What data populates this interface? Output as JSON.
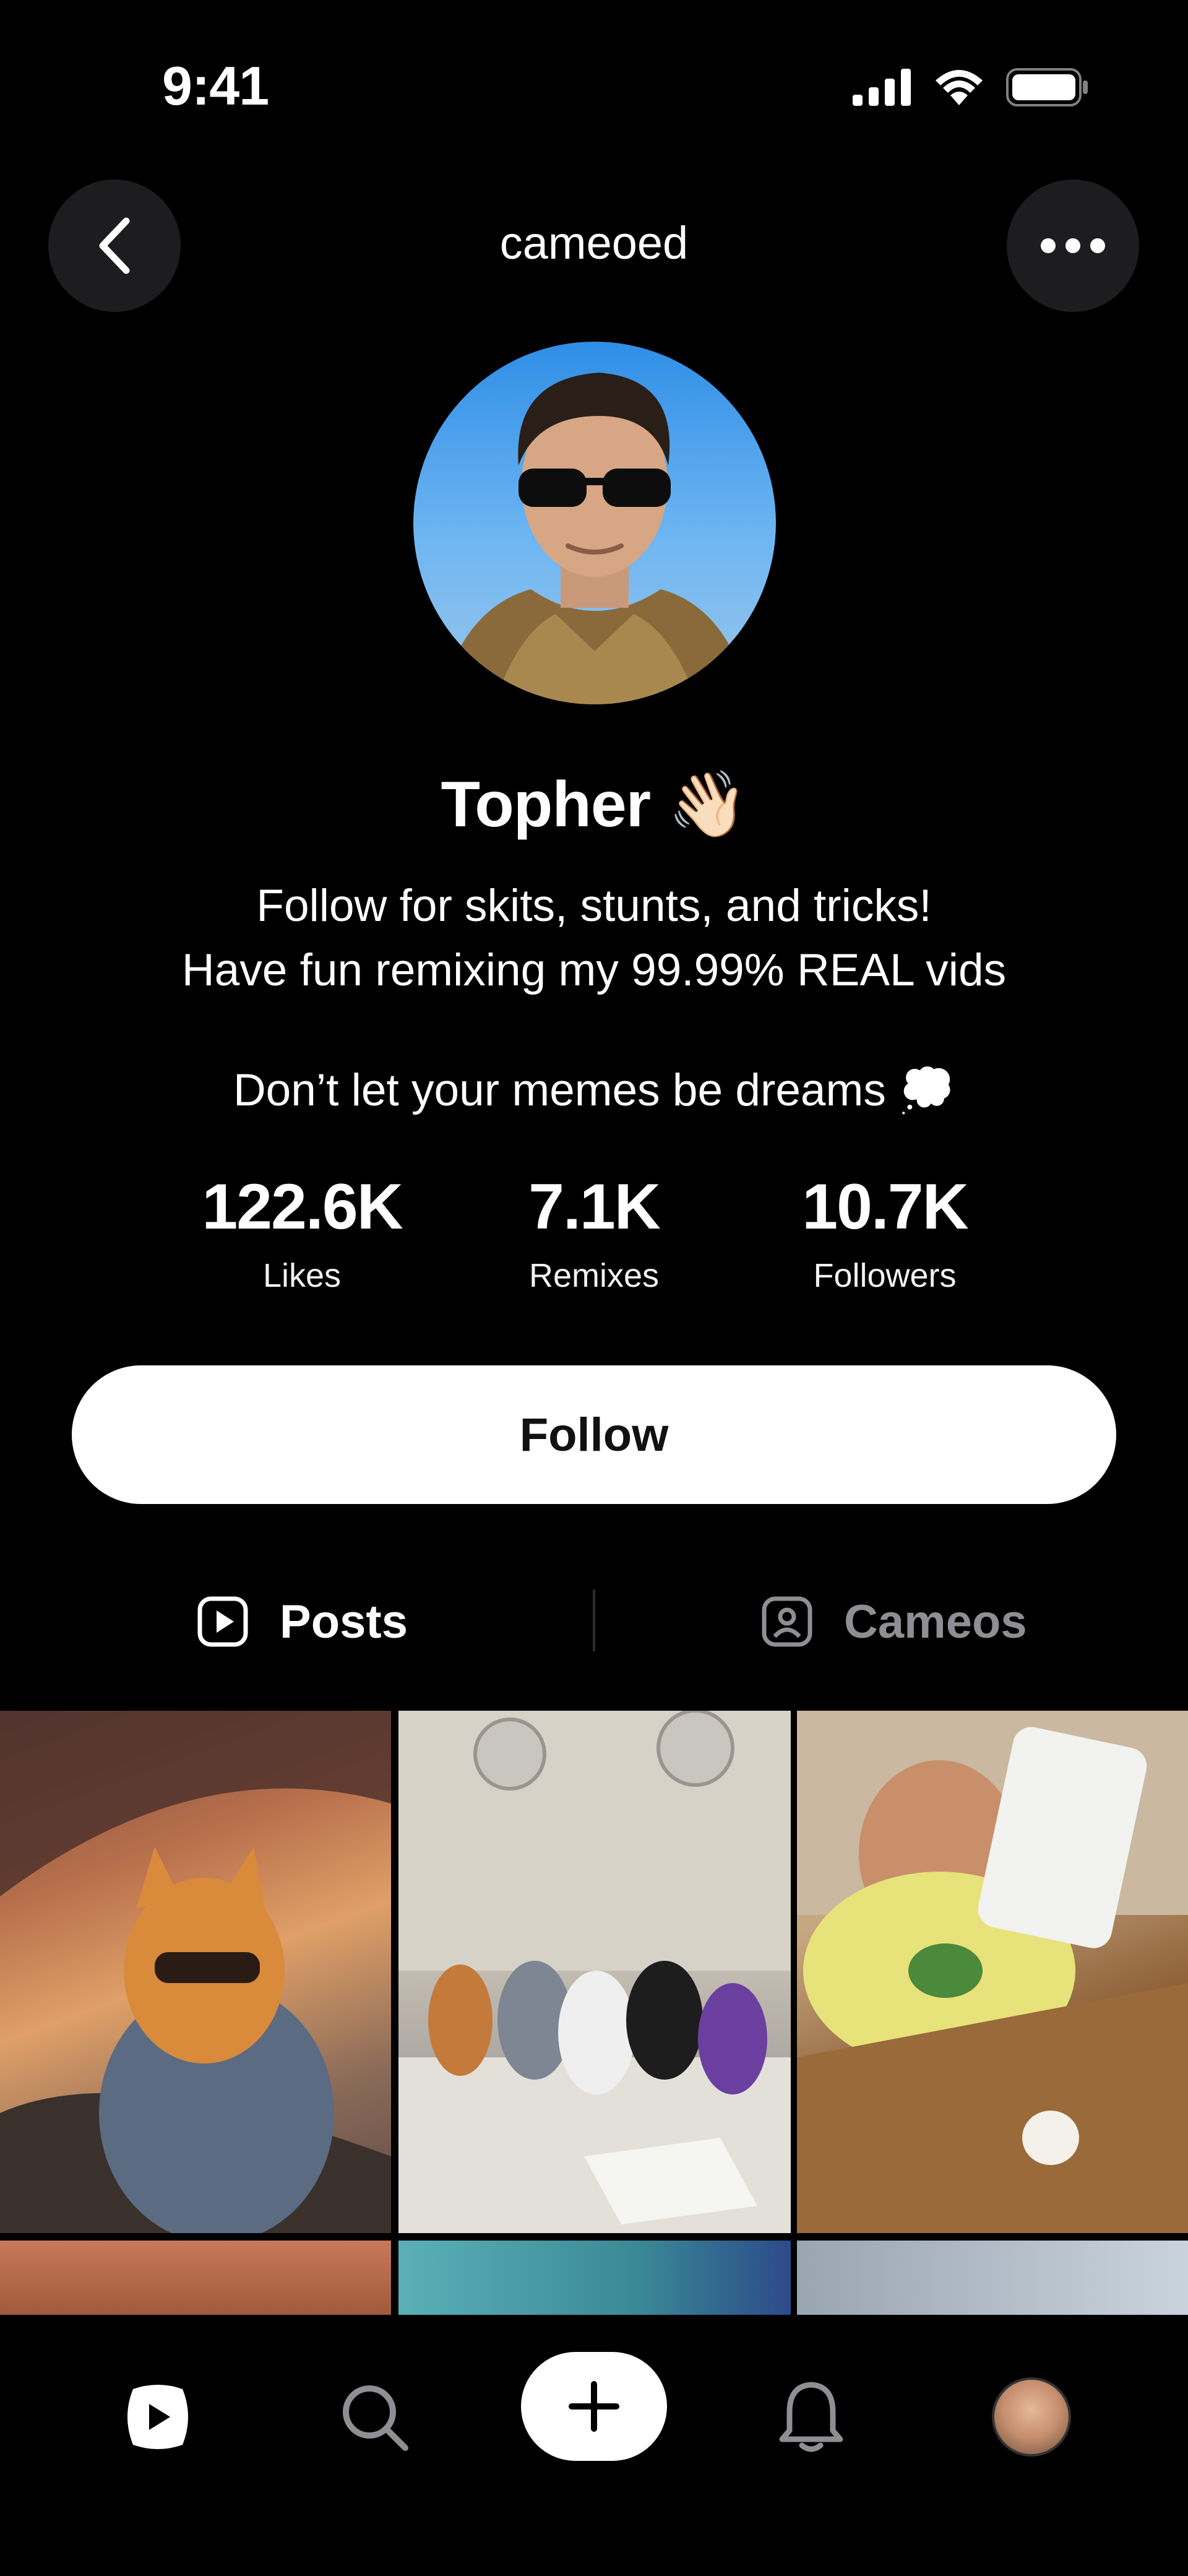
{
  "status_bar": {
    "time": "9:41"
  },
  "header": {
    "username": "cameoed"
  },
  "profile": {
    "name": "Topher 👋🏻",
    "bio_line1": "Follow for skits, stunts, and tricks!",
    "bio_line2": "Have fun remixing my 99.99% REAL vids",
    "tagline": "Don’t let your memes be dreams 💭"
  },
  "stats": [
    {
      "value": "122.6K",
      "label": "Likes"
    },
    {
      "value": "7.1K",
      "label": "Remixes"
    },
    {
      "value": "10.7K",
      "label": "Followers"
    }
  ],
  "actions": {
    "follow_label": "Follow"
  },
  "tabs": [
    {
      "label": "Posts",
      "icon": "play-square-icon",
      "active": true
    },
    {
      "label": "Cameos",
      "icon": "person-square-icon",
      "active": false
    }
  ],
  "grid": [
    {
      "subject": "cat wearing sunglasses and denim jacket driving a car"
    },
    {
      "subject": "cats in colorful shirts baking in a kitchen"
    },
    {
      "subject": "baby tapping an egg on a wooden table"
    },
    {
      "subject": "canyon landscape"
    },
    {
      "subject": "blue wall and sky"
    },
    {
      "subject": "city tower"
    }
  ],
  "bottom_nav": [
    {
      "name": "home",
      "icon": "play-home-icon",
      "active": true
    },
    {
      "name": "search",
      "icon": "search-icon",
      "active": false
    },
    {
      "name": "create",
      "icon": "plus-icon",
      "active": false
    },
    {
      "name": "notifications",
      "icon": "bell-icon",
      "active": false
    },
    {
      "name": "profile",
      "icon": "avatar-icon",
      "active": false
    }
  ],
  "colors": {
    "background": "#000000",
    "surface": "#1d1d1f",
    "inactive": "#8e8e93",
    "button": "#ffffff"
  }
}
